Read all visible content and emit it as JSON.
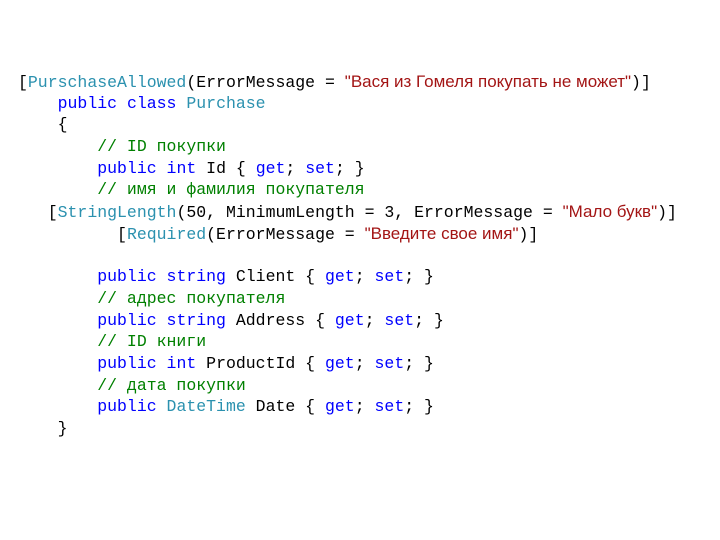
{
  "colors": {
    "keyword": "#0000ff",
    "type": "#2b91af",
    "comment": "#008000",
    "string": "#a31515",
    "plain": "#000000"
  },
  "lines": [
    {
      "indent": 0,
      "tokens": [
        {
          "t": "pl",
          "v": "["
        },
        {
          "t": "type",
          "v": "PurschaseAllowed"
        },
        {
          "t": "pl",
          "v": "(ErrorMessage = "
        },
        {
          "t": "str",
          "v": "\"Вася из Гомеля покупать не может\""
        },
        {
          "t": "pl",
          "v": ")]"
        }
      ]
    },
    {
      "indent": 4,
      "tokens": [
        {
          "t": "kw",
          "v": "public"
        },
        {
          "t": "pl",
          "v": " "
        },
        {
          "t": "kw",
          "v": "class"
        },
        {
          "t": "pl",
          "v": " "
        },
        {
          "t": "type",
          "v": "Purchase"
        }
      ]
    },
    {
      "indent": 4,
      "tokens": [
        {
          "t": "pl",
          "v": "{"
        }
      ]
    },
    {
      "indent": 8,
      "tokens": [
        {
          "t": "cm",
          "v": "// ID покупки"
        }
      ]
    },
    {
      "indent": 8,
      "tokens": [
        {
          "t": "kw",
          "v": "public"
        },
        {
          "t": "pl",
          "v": " "
        },
        {
          "t": "kw",
          "v": "int"
        },
        {
          "t": "pl",
          "v": " Id { "
        },
        {
          "t": "kw",
          "v": "get"
        },
        {
          "t": "pl",
          "v": "; "
        },
        {
          "t": "kw",
          "v": "set"
        },
        {
          "t": "pl",
          "v": "; }"
        }
      ]
    },
    {
      "indent": 8,
      "tokens": [
        {
          "t": "cm",
          "v": "// имя и фамилия покупателя"
        }
      ]
    },
    {
      "indent": 3,
      "tokens": [
        {
          "t": "pl",
          "v": "["
        },
        {
          "t": "type",
          "v": "StringLength"
        },
        {
          "t": "pl",
          "v": "(50, MinimumLength = 3, ErrorMessage = "
        },
        {
          "t": "str",
          "v": "\"Мало букв\""
        },
        {
          "t": "pl",
          "v": ")]"
        }
      ]
    },
    {
      "indent": 10,
      "tokens": [
        {
          "t": "pl",
          "v": "["
        },
        {
          "t": "type",
          "v": "Required"
        },
        {
          "t": "pl",
          "v": "(ErrorMessage = "
        },
        {
          "t": "str",
          "v": "\"Введите свое имя\""
        },
        {
          "t": "pl",
          "v": ")]"
        }
      ]
    },
    {
      "indent": 0,
      "tokens": []
    },
    {
      "indent": 8,
      "tokens": [
        {
          "t": "kw",
          "v": "public"
        },
        {
          "t": "pl",
          "v": " "
        },
        {
          "t": "kw",
          "v": "string"
        },
        {
          "t": "pl",
          "v": " Client { "
        },
        {
          "t": "kw",
          "v": "get"
        },
        {
          "t": "pl",
          "v": "; "
        },
        {
          "t": "kw",
          "v": "set"
        },
        {
          "t": "pl",
          "v": "; }"
        }
      ]
    },
    {
      "indent": 8,
      "tokens": [
        {
          "t": "cm",
          "v": "// адрес покупателя"
        }
      ]
    },
    {
      "indent": 8,
      "tokens": [
        {
          "t": "kw",
          "v": "public"
        },
        {
          "t": "pl",
          "v": " "
        },
        {
          "t": "kw",
          "v": "string"
        },
        {
          "t": "pl",
          "v": " Address { "
        },
        {
          "t": "kw",
          "v": "get"
        },
        {
          "t": "pl",
          "v": "; "
        },
        {
          "t": "kw",
          "v": "set"
        },
        {
          "t": "pl",
          "v": "; }"
        }
      ]
    },
    {
      "indent": 8,
      "tokens": [
        {
          "t": "cm",
          "v": "// ID книги"
        }
      ]
    },
    {
      "indent": 8,
      "tokens": [
        {
          "t": "kw",
          "v": "public"
        },
        {
          "t": "pl",
          "v": " "
        },
        {
          "t": "kw",
          "v": "int"
        },
        {
          "t": "pl",
          "v": " ProductId { "
        },
        {
          "t": "kw",
          "v": "get"
        },
        {
          "t": "pl",
          "v": "; "
        },
        {
          "t": "kw",
          "v": "set"
        },
        {
          "t": "pl",
          "v": "; }"
        }
      ]
    },
    {
      "indent": 8,
      "tokens": [
        {
          "t": "cm",
          "v": "// дата покупки"
        }
      ]
    },
    {
      "indent": 8,
      "tokens": [
        {
          "t": "kw",
          "v": "public"
        },
        {
          "t": "pl",
          "v": " "
        },
        {
          "t": "type",
          "v": "DateTime"
        },
        {
          "t": "pl",
          "v": " Date { "
        },
        {
          "t": "kw",
          "v": "get"
        },
        {
          "t": "pl",
          "v": "; "
        },
        {
          "t": "kw",
          "v": "set"
        },
        {
          "t": "pl",
          "v": "; }"
        }
      ]
    },
    {
      "indent": 4,
      "tokens": [
        {
          "t": "pl",
          "v": "}"
        }
      ]
    }
  ]
}
